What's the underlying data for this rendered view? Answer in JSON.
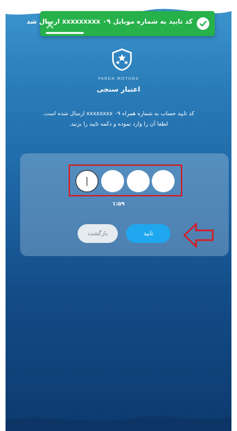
{
  "toast": {
    "message": "کد تایید به شماره موبایل xxxxxxxxx ۰۹ ارسال شد",
    "icon": "check-icon",
    "close_icon": "close-icon",
    "color": "#27b14b"
  },
  "brand": {
    "name": "PARDA MOTORS",
    "logo_icon": "shield-stars-icon"
  },
  "page": {
    "title": "اعتبار سنجی",
    "description_line1": "کد تایید حساب به شماره همراه xxxxxxxx ۰۹ ارسال شده است.",
    "description_line2": "لطفا آن را وارد نموده و دکمه تایید را بزنید."
  },
  "otp": {
    "digits": [
      "",
      "",
      "",
      ""
    ],
    "timer": "۱:۵۹"
  },
  "buttons": {
    "confirm_label": "تایید",
    "back_label": "بازگشت"
  },
  "colors": {
    "accent": "#1ea7ee",
    "annotation_red": "#d0202a",
    "background_top": "#3d96cf",
    "background_bottom": "#0d3a6e"
  }
}
